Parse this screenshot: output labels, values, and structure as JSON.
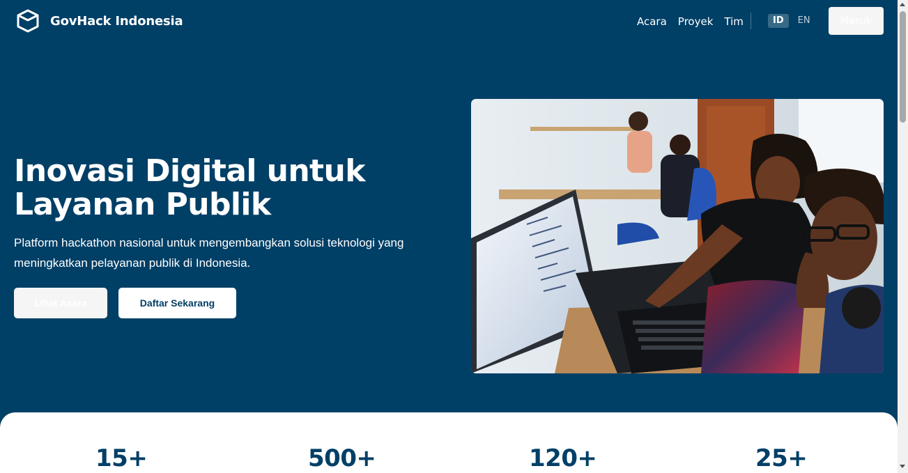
{
  "brand": {
    "name": "GovHack Indonesia",
    "icon": "cube-logo-icon"
  },
  "nav": {
    "items": [
      "Acara",
      "Proyek",
      "Tim"
    ]
  },
  "language": {
    "options": [
      "ID",
      "EN"
    ],
    "active": "ID"
  },
  "header": {
    "login_label": "Masuk"
  },
  "hero": {
    "title": "Inovasi Digital untuk Layanan Publik",
    "subtitle": "Platform hackathon nasional untuk mengembangkan solusi teknologi yang meningkatkan pelayanan publik di Indonesia.",
    "secondary_button": "Lihat Acara",
    "primary_button": "Daftar Sekarang",
    "image": "photo-people-coding-at-laptops"
  },
  "stats": {
    "values": [
      "15+",
      "500+",
      "120+",
      "25+"
    ]
  },
  "colors": {
    "primary": "#003f66",
    "white": "#ffffff",
    "light_button": "#f5f5f5"
  }
}
